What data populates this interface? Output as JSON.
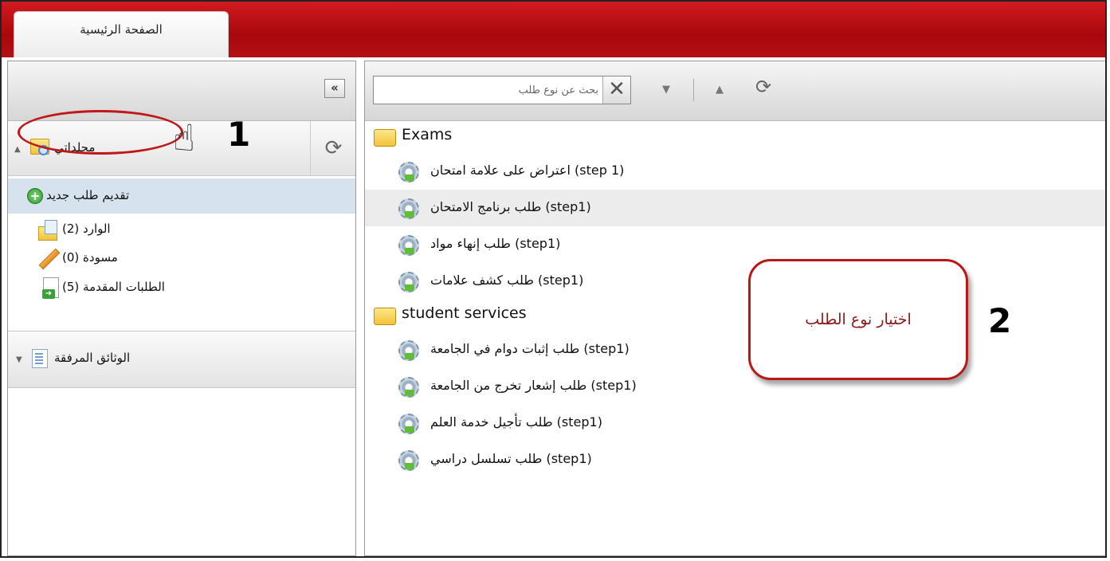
{
  "header": {
    "tab_label": "الصفحة الرئيسية"
  },
  "left_panel": {
    "collapse_label": "«",
    "refresh_label": "⟳",
    "folders_section": {
      "title": "مجلداتي",
      "items": [
        {
          "label": "تقديم طلب جديد"
        },
        {
          "label": "الوارد (2)"
        },
        {
          "label": "مسودة (0)"
        },
        {
          "label": "الطلبات المقدمة (5)"
        }
      ]
    },
    "attachments_section": {
      "title": "الوثائق المرفقة"
    }
  },
  "annotations": {
    "step1_number": "1",
    "step2_number": "2",
    "callout_text": "اختيار نوع الطلب"
  },
  "right_panel": {
    "search": {
      "placeholder": "بحث عن نوع طلب",
      "clear_label": "✕"
    },
    "toolbar": {
      "down_label": "▼",
      "up_label": "▲",
      "refresh_label": "⟳"
    },
    "categories": [
      {
        "name": "Exams",
        "items": [
          {
            "label": "(1 step) اعتراض على علامة امتحان"
          },
          {
            "label": "(step1) طلب برنامج الامتحان"
          },
          {
            "label": "(step1) طلب إنهاء مواد"
          },
          {
            "label": "(step1) طلب كشف علامات"
          }
        ]
      },
      {
        "name": "student services",
        "items": [
          {
            "label": "(step1) طلب إثبات دوام في الجامعة"
          },
          {
            "label": "(step1) طلب إشعار تخرج من الجامعة"
          },
          {
            "label": "(step1) طلب تأجيل خدمة العلم"
          },
          {
            "label": "(step1) طلب تسلسل دراسي"
          }
        ]
      }
    ]
  },
  "colors": {
    "header_red": "#c0141a",
    "selected_row": "#d6e3ee",
    "highlight_row": "#ececec",
    "callout_border": "#b81818"
  }
}
